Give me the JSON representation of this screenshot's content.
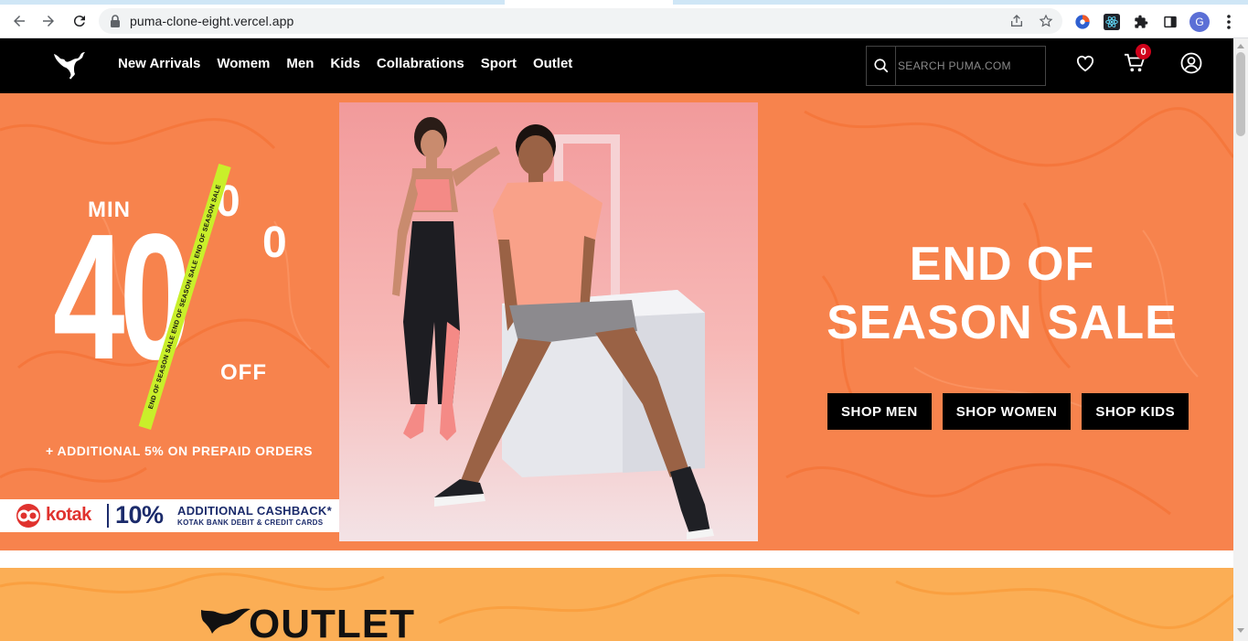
{
  "browser": {
    "url": "puma-clone-eight.vercel.app",
    "profile_initial": "G"
  },
  "header": {
    "logo_alt": "PUMA",
    "nav": [
      "New Arrivals",
      "Womem",
      "Men",
      "Kids",
      "Collabrations",
      "Sport",
      "Outlet"
    ],
    "search_placeholder": "SEARCH PUMA.COM",
    "cart_count": "0"
  },
  "hero": {
    "promo": {
      "min": "MIN",
      "big": "40",
      "percent_top": "0",
      "percent_bottom": "0",
      "off": "OFF",
      "tape": "END OF SEASON SALE   END OF SEASON SALE   END OF SEASON SALE",
      "extra": "+ ADDITIONAL 5% ON PREPAID ORDERS"
    },
    "kotak": {
      "brand": "kotak",
      "percent": "10%",
      "line1": "ADDITIONAL CASHBACK*",
      "line2": "KOTAK BANK DEBIT & CREDIT CARDS"
    },
    "title_line1": "END OF",
    "title_line2": "SEASON SALE",
    "buttons": {
      "men": "SHOP MEN",
      "women": "SHOP WOMEN",
      "kids": "SHOP KIDS"
    }
  },
  "outlet": {
    "title": "OUTLET"
  },
  "colors": {
    "hero_bg": "#f7834d",
    "outlet_bg": "#fbae55",
    "header_bg": "#000000",
    "accent_tape": "#c9ef2a",
    "badge": "#d0021b",
    "kotak_red": "#e0322e",
    "kotak_navy": "#1b2b6b"
  },
  "icons": [
    "back-icon",
    "forward-icon",
    "reload-icon",
    "lock-icon",
    "share-icon",
    "star-icon",
    "extension-icons",
    "puzzle-icon",
    "sidepanel-icon",
    "menu-icon",
    "puma-logo-icon",
    "search-icon",
    "heart-icon",
    "cart-icon",
    "user-icon"
  ]
}
